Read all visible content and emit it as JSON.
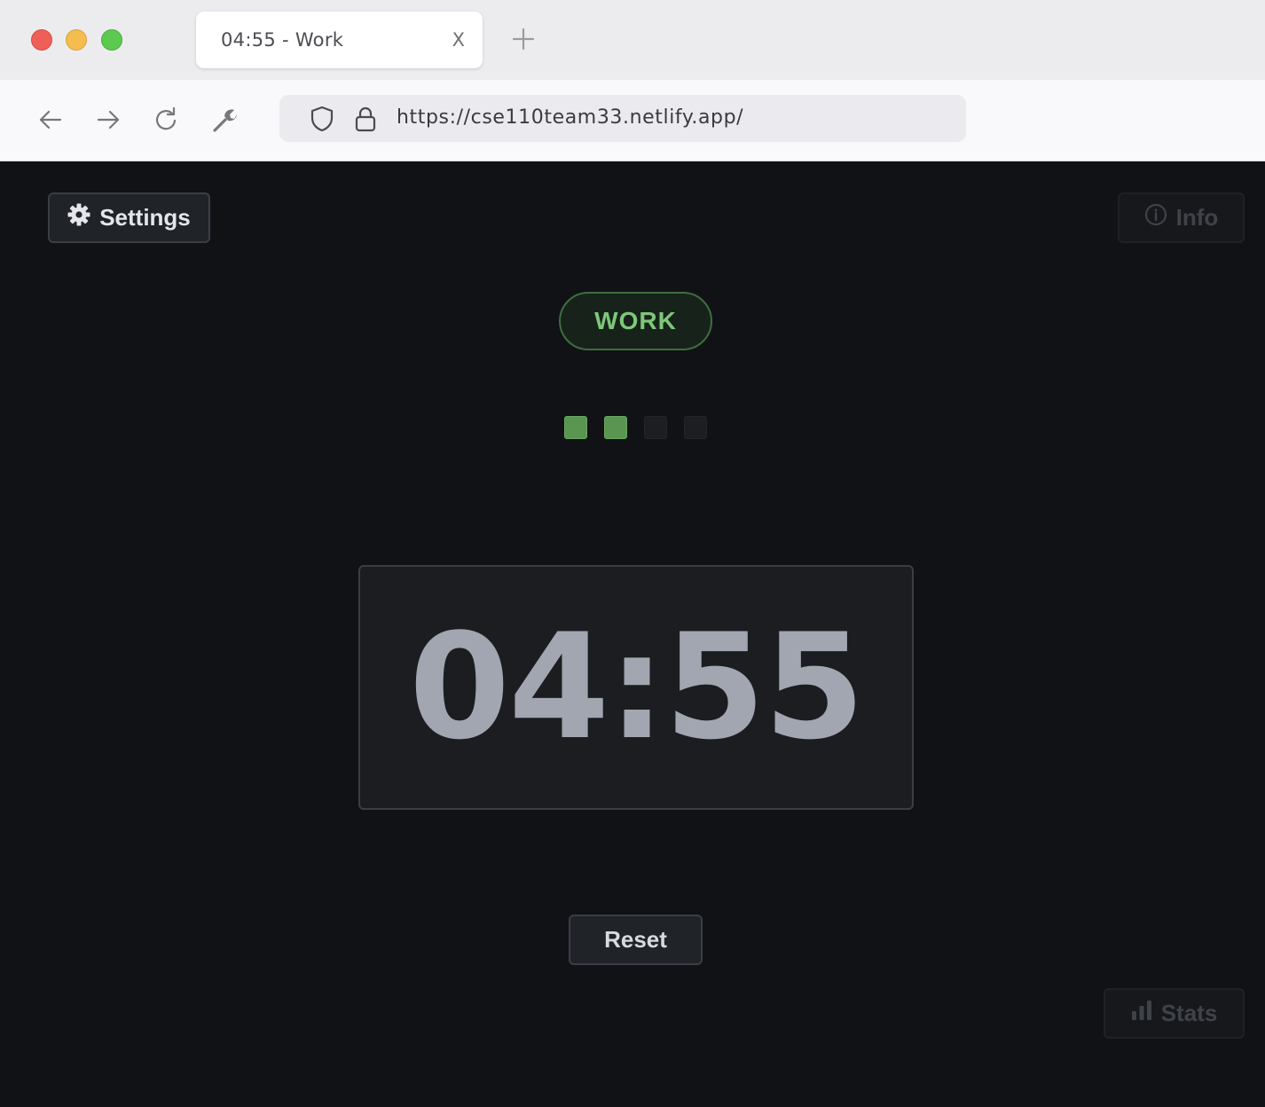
{
  "browser": {
    "tab": {
      "title": "04:55 - Work",
      "close_label": "X"
    },
    "url": "https://cse110team33.netlify.app/",
    "icons": [
      "back-arrow-icon",
      "forward-arrow-icon",
      "reload-icon",
      "wrench-icon",
      "shield-icon",
      "lock-icon",
      "new-tab-plus-icon"
    ]
  },
  "app": {
    "settings_label": "Settings",
    "info_label": "Info",
    "mode_label": "WORK",
    "session_progress": {
      "completed": 2,
      "total": 4
    },
    "timer": "04:55",
    "reset_label": "Reset",
    "stats_label": "Stats"
  },
  "colors": {
    "background": "#111216",
    "accent_green": "#7ec77a",
    "progress_on": "#5a9552",
    "timer_text": "#a2a6b0"
  }
}
